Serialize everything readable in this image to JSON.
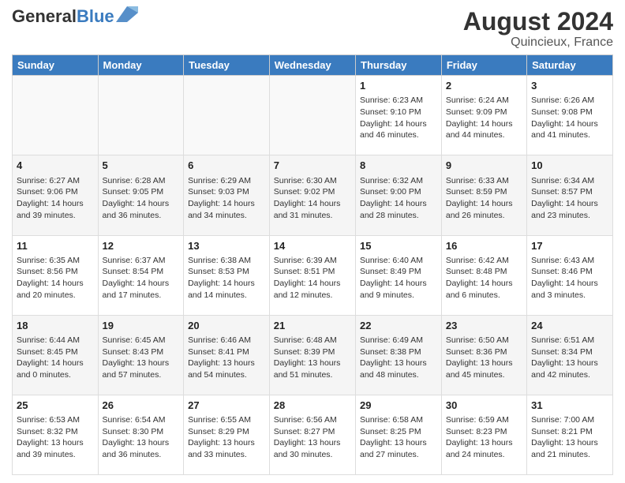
{
  "header": {
    "logo_general": "General",
    "logo_blue": "Blue",
    "month_year": "August 2024",
    "location": "Quincieux, France"
  },
  "days_of_week": [
    "Sunday",
    "Monday",
    "Tuesday",
    "Wednesday",
    "Thursday",
    "Friday",
    "Saturday"
  ],
  "weeks": [
    [
      {
        "day": "",
        "info": ""
      },
      {
        "day": "",
        "info": ""
      },
      {
        "day": "",
        "info": ""
      },
      {
        "day": "",
        "info": ""
      },
      {
        "day": "1",
        "info": "Sunrise: 6:23 AM\nSunset: 9:10 PM\nDaylight: 14 hours and 46 minutes."
      },
      {
        "day": "2",
        "info": "Sunrise: 6:24 AM\nSunset: 9:09 PM\nDaylight: 14 hours and 44 minutes."
      },
      {
        "day": "3",
        "info": "Sunrise: 6:26 AM\nSunset: 9:08 PM\nDaylight: 14 hours and 41 minutes."
      }
    ],
    [
      {
        "day": "4",
        "info": "Sunrise: 6:27 AM\nSunset: 9:06 PM\nDaylight: 14 hours and 39 minutes."
      },
      {
        "day": "5",
        "info": "Sunrise: 6:28 AM\nSunset: 9:05 PM\nDaylight: 14 hours and 36 minutes."
      },
      {
        "day": "6",
        "info": "Sunrise: 6:29 AM\nSunset: 9:03 PM\nDaylight: 14 hours and 34 minutes."
      },
      {
        "day": "7",
        "info": "Sunrise: 6:30 AM\nSunset: 9:02 PM\nDaylight: 14 hours and 31 minutes."
      },
      {
        "day": "8",
        "info": "Sunrise: 6:32 AM\nSunset: 9:00 PM\nDaylight: 14 hours and 28 minutes."
      },
      {
        "day": "9",
        "info": "Sunrise: 6:33 AM\nSunset: 8:59 PM\nDaylight: 14 hours and 26 minutes."
      },
      {
        "day": "10",
        "info": "Sunrise: 6:34 AM\nSunset: 8:57 PM\nDaylight: 14 hours and 23 minutes."
      }
    ],
    [
      {
        "day": "11",
        "info": "Sunrise: 6:35 AM\nSunset: 8:56 PM\nDaylight: 14 hours and 20 minutes."
      },
      {
        "day": "12",
        "info": "Sunrise: 6:37 AM\nSunset: 8:54 PM\nDaylight: 14 hours and 17 minutes."
      },
      {
        "day": "13",
        "info": "Sunrise: 6:38 AM\nSunset: 8:53 PM\nDaylight: 14 hours and 14 minutes."
      },
      {
        "day": "14",
        "info": "Sunrise: 6:39 AM\nSunset: 8:51 PM\nDaylight: 14 hours and 12 minutes."
      },
      {
        "day": "15",
        "info": "Sunrise: 6:40 AM\nSunset: 8:49 PM\nDaylight: 14 hours and 9 minutes."
      },
      {
        "day": "16",
        "info": "Sunrise: 6:42 AM\nSunset: 8:48 PM\nDaylight: 14 hours and 6 minutes."
      },
      {
        "day": "17",
        "info": "Sunrise: 6:43 AM\nSunset: 8:46 PM\nDaylight: 14 hours and 3 minutes."
      }
    ],
    [
      {
        "day": "18",
        "info": "Sunrise: 6:44 AM\nSunset: 8:45 PM\nDaylight: 14 hours and 0 minutes."
      },
      {
        "day": "19",
        "info": "Sunrise: 6:45 AM\nSunset: 8:43 PM\nDaylight: 13 hours and 57 minutes."
      },
      {
        "day": "20",
        "info": "Sunrise: 6:46 AM\nSunset: 8:41 PM\nDaylight: 13 hours and 54 minutes."
      },
      {
        "day": "21",
        "info": "Sunrise: 6:48 AM\nSunset: 8:39 PM\nDaylight: 13 hours and 51 minutes."
      },
      {
        "day": "22",
        "info": "Sunrise: 6:49 AM\nSunset: 8:38 PM\nDaylight: 13 hours and 48 minutes."
      },
      {
        "day": "23",
        "info": "Sunrise: 6:50 AM\nSunset: 8:36 PM\nDaylight: 13 hours and 45 minutes."
      },
      {
        "day": "24",
        "info": "Sunrise: 6:51 AM\nSunset: 8:34 PM\nDaylight: 13 hours and 42 minutes."
      }
    ],
    [
      {
        "day": "25",
        "info": "Sunrise: 6:53 AM\nSunset: 8:32 PM\nDaylight: 13 hours and 39 minutes."
      },
      {
        "day": "26",
        "info": "Sunrise: 6:54 AM\nSunset: 8:30 PM\nDaylight: 13 hours and 36 minutes."
      },
      {
        "day": "27",
        "info": "Sunrise: 6:55 AM\nSunset: 8:29 PM\nDaylight: 13 hours and 33 minutes."
      },
      {
        "day": "28",
        "info": "Sunrise: 6:56 AM\nSunset: 8:27 PM\nDaylight: 13 hours and 30 minutes."
      },
      {
        "day": "29",
        "info": "Sunrise: 6:58 AM\nSunset: 8:25 PM\nDaylight: 13 hours and 27 minutes."
      },
      {
        "day": "30",
        "info": "Sunrise: 6:59 AM\nSunset: 8:23 PM\nDaylight: 13 hours and 24 minutes."
      },
      {
        "day": "31",
        "info": "Sunrise: 7:00 AM\nSunset: 8:21 PM\nDaylight: 13 hours and 21 minutes."
      }
    ]
  ]
}
